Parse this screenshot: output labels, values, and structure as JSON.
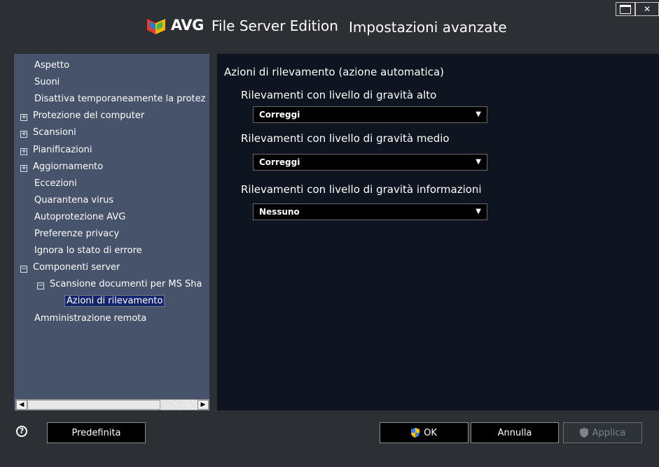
{
  "header": {
    "brand": "AVG",
    "edition": "File Server Edition",
    "title": "Impostazioni avanzate"
  },
  "sidebar": {
    "items": [
      {
        "label": "Aspetto",
        "level": 0,
        "expander": ""
      },
      {
        "label": "Suoni",
        "level": 0,
        "expander": ""
      },
      {
        "label": "Disattiva temporaneamente la protez",
        "level": 0,
        "expander": ""
      },
      {
        "label": "Protezione del computer",
        "level": 0,
        "expander": "+"
      },
      {
        "label": "Scansioni",
        "level": 0,
        "expander": "+"
      },
      {
        "label": "Pianificazioni",
        "level": 0,
        "expander": "+"
      },
      {
        "label": "Aggiornamento",
        "level": 0,
        "expander": "+"
      },
      {
        "label": "Eccezioni",
        "level": 0,
        "expander": ""
      },
      {
        "label": "Quarantena virus",
        "level": 0,
        "expander": ""
      },
      {
        "label": "Autoprotezione AVG",
        "level": 0,
        "expander": ""
      },
      {
        "label": "Preferenze privacy",
        "level": 0,
        "expander": ""
      },
      {
        "label": "Ignora lo stato di errore",
        "level": 0,
        "expander": ""
      },
      {
        "label": "Componenti server",
        "level": 0,
        "expander": "−"
      },
      {
        "label": "Scansione documenti per MS Sha",
        "level": 1,
        "expander": "−"
      },
      {
        "label": "Azioni di rilevamento",
        "level": 2,
        "expander": "",
        "selected": true
      },
      {
        "label": "Amministrazione remota",
        "level": 0,
        "expander": ""
      }
    ]
  },
  "content": {
    "section_title": "Azioni di rilevamento (azione automatica)",
    "high": {
      "label": "Rilevamenti con livello di gravità alto",
      "value": "Correggi"
    },
    "medium": {
      "label": "Rilevamenti con livello di gravità medio",
      "value": "Correggi"
    },
    "info": {
      "label": "Rilevamenti con livello di gravità informazioni",
      "value": "Nessuno"
    }
  },
  "footer": {
    "default_label": "Predefinita",
    "ok_label": "OK",
    "cancel_label": "Annulla",
    "apply_label": "Applica"
  },
  "colors": {
    "background": "#2c3035",
    "sidebar": "#46536a",
    "content": "#0f1520",
    "selection": "#15256b"
  }
}
